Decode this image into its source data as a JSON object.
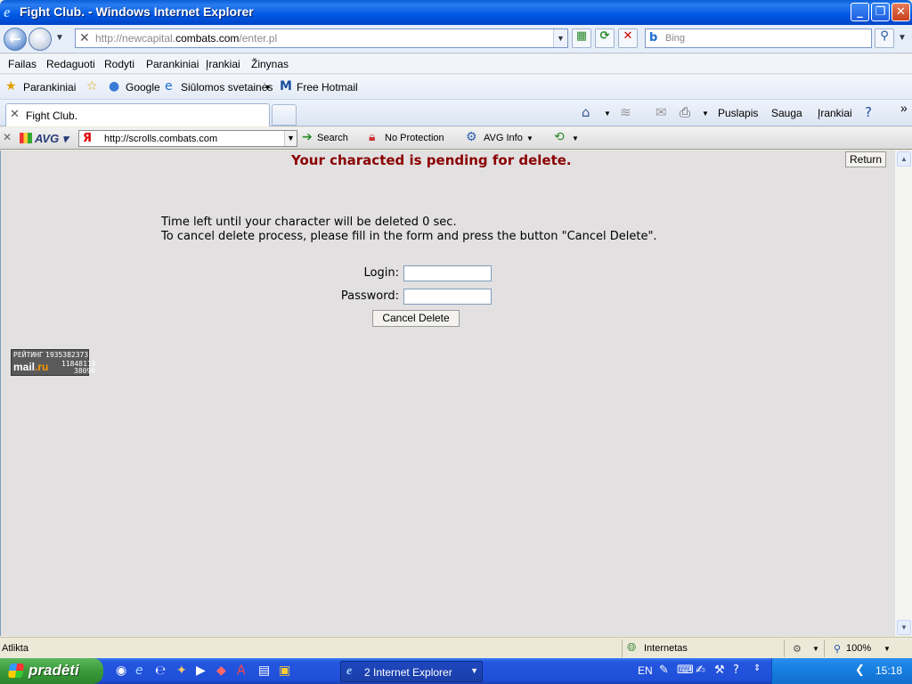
{
  "window": {
    "title": "Fight Club. - Windows Internet Explorer"
  },
  "address": {
    "url_prefix": "http://newcapital.",
    "url_domain": "combats.com",
    "url_suffix": "/enter.pl"
  },
  "search": {
    "placeholder": "Bing"
  },
  "menu": [
    "Failas",
    "Redaguoti",
    "Rodyti",
    "Parankiniai",
    "Įrankiai",
    "Žinynas"
  ],
  "favorites": {
    "label": "Parankiniai",
    "items": [
      "Google",
      "Siūlomos svetainės",
      "Free Hotmail"
    ]
  },
  "tab": {
    "title": "Fight Club."
  },
  "commandbar": {
    "page": "Puslapis",
    "safety": "Sauga",
    "tools": "Įrankiai"
  },
  "avg": {
    "logo": "AVG",
    "url": "http://scrolls.combats.com",
    "search": "Search",
    "protection": "No Protection",
    "info": "AVG Info"
  },
  "page": {
    "pending_title": "Your characted is pending for delete.",
    "return_label": "Return",
    "time_left": "Time left until your character will be deleted 0 sec.",
    "instructions": "To cancel delete process, please fill in the form and press the button \"Cancel Delete\".",
    "login_label": "Login:",
    "password_label": "Password:",
    "login_value": "",
    "password_value": "",
    "cancel_label": "Cancel Delete"
  },
  "counter": {
    "label": "РЕЙТИНГ",
    "n1": "1935382373",
    "mail": "mail",
    "ru": ".ru",
    "n2": "11848118",
    "n3": "38090"
  },
  "status": {
    "left": "Atlikta",
    "zone": "Internetas",
    "zoom": "100%"
  },
  "taskbar": {
    "start": "pradėti",
    "task_label": "2 Internet Explorer",
    "lang": "EN",
    "clock": "15:18"
  }
}
